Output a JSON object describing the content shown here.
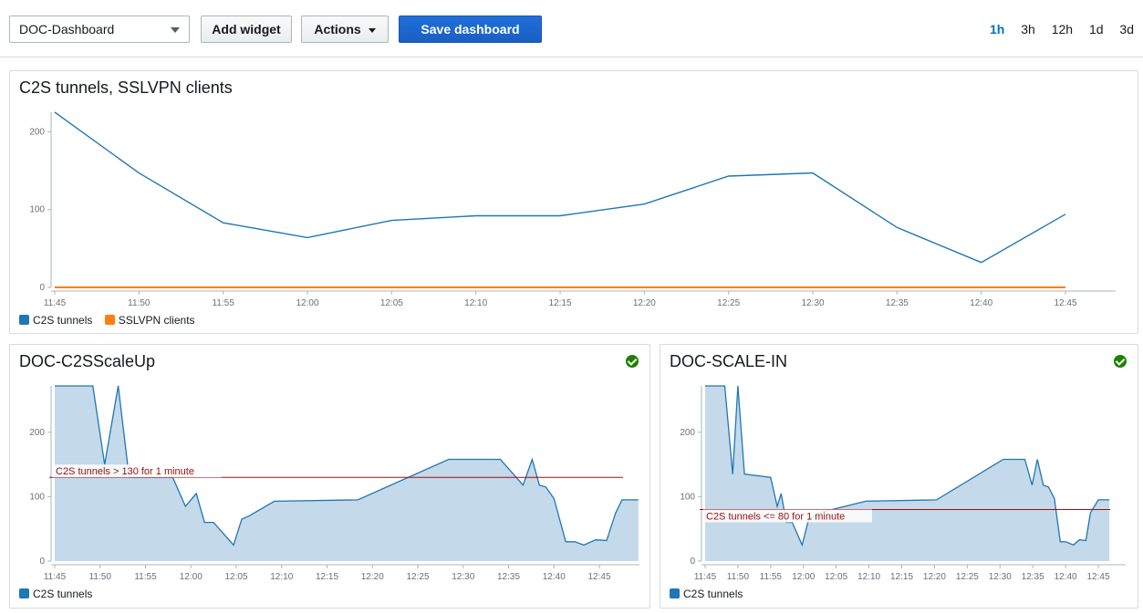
{
  "toolbar": {
    "dashboard_select": "DOC-Dashboard",
    "add_widget": "Add widget",
    "actions": "Actions",
    "save_dashboard": "Save dashboard",
    "time_ranges": [
      "1h",
      "3h",
      "12h",
      "1d",
      "3d"
    ],
    "active_range": "1h"
  },
  "colors": {
    "c2s": "#1f77b4",
    "sslvpn": "#ff7f0e",
    "threshold": "#d13212",
    "area": "#c4d9ea",
    "ok": "#1d8102"
  },
  "widgets": {
    "main": {
      "title": "C2S tunnels, SSLVPN clients"
    },
    "scaleup": {
      "title": "DOC-C2SScaleUp",
      "threshold_label": "C2S tunnels > 130 for 1 minute",
      "state": "ok"
    },
    "scalein": {
      "title": "DOC-SCALE-IN",
      "threshold_label": "C2S tunnels <= 80 for 1 minute",
      "state": "ok"
    }
  },
  "legend": {
    "c2s": "C2S tunnels",
    "sslvpn": "SSLVPN clients"
  },
  "chart_data": [
    {
      "type": "line",
      "title": "C2S tunnels, SSLVPN clients",
      "x": [
        "11:45",
        "11:50",
        "11:55",
        "12:00",
        "12:05",
        "12:10",
        "12:15",
        "12:20",
        "12:25",
        "12:30",
        "12:35",
        "12:40",
        "12:45"
      ],
      "x_ticks": [
        "11:45",
        "11:50",
        "11:55",
        "12:00",
        "12:05",
        "12:10",
        "12:15",
        "12:20",
        "12:25",
        "12:30",
        "12:35",
        "12:40",
        "12:45"
      ],
      "y_ticks": [
        0,
        100,
        200
      ],
      "ylim": [
        0,
        225
      ],
      "series": [
        {
          "name": "C2S tunnels",
          "values": [
            225,
            147,
            83,
            64,
            86,
            92,
            92,
            107,
            143,
            147,
            77,
            32,
            94
          ]
        },
        {
          "name": "SSLVPN clients",
          "values": [
            0,
            0,
            0,
            0,
            0,
            0,
            0,
            0,
            0,
            0,
            0,
            0,
            0
          ]
        }
      ],
      "legend": "bottom-left",
      "grid": false
    },
    {
      "type": "area",
      "title": "DOC-C2SScaleUp",
      "x_ticks": [
        "11:45",
        "11:50",
        "11:55",
        "12:00",
        "12:05",
        "12:10",
        "12:15",
        "12:20",
        "12:25",
        "12:30",
        "12:35",
        "12:40",
        "12:45"
      ],
      "y_ticks": [
        0,
        100,
        200
      ],
      "ylim": [
        0,
        272
      ],
      "x_minutes": [
        0,
        4.2,
        5.5,
        7,
        8.2,
        13,
        14.4,
        15.6,
        16.5,
        17.5,
        19.7,
        20.6,
        21.4,
        24.2,
        33.4,
        43.4,
        49.1,
        51.6,
        52.6,
        53.4,
        54.1,
        55,
        56.3,
        57.3,
        58.3,
        59.6,
        60.8,
        61.8,
        62.5,
        64.3
      ],
      "values": [
        272,
        272,
        150,
        272,
        130,
        130,
        85,
        105,
        60,
        60,
        25,
        65,
        70,
        93,
        95,
        158,
        158,
        118,
        158,
        118,
        115,
        97,
        30,
        30,
        25,
        33,
        32,
        75,
        95,
        95
      ],
      "series": [
        {
          "name": "C2S tunnels"
        }
      ],
      "threshold": {
        "value": 130,
        "label": "C2S tunnels > 130 for 1 minute"
      },
      "legend": "bottom-left"
    },
    {
      "type": "area",
      "title": "DOC-SCALE-IN",
      "x_ticks": [
        "11:45",
        "11:50",
        "11:55",
        "12:00",
        "12:05",
        "12:10",
        "12:15",
        "12:20",
        "12:25",
        "12:30",
        "12:35",
        "12:40",
        "12:45"
      ],
      "y_ticks": [
        0,
        100,
        200
      ],
      "ylim": [
        0,
        272
      ],
      "x_minutes": [
        0,
        3,
        4.2,
        5,
        6,
        10,
        11,
        11.6,
        12.4,
        13.3,
        14.8,
        15.8,
        17.3,
        24.5,
        35.3,
        45.5,
        48.8,
        49.9,
        50.7,
        51.6,
        52.4,
        53.3,
        54.2,
        55,
        56.2,
        57.1,
        58.1,
        58.8,
        60,
        61.7
      ],
      "values": [
        272,
        272,
        135,
        272,
        135,
        130,
        85,
        105,
        60,
        60,
        25,
        65,
        75,
        93,
        95,
        158,
        158,
        118,
        158,
        118,
        115,
        97,
        30,
        30,
        25,
        33,
        32,
        75,
        95,
        95
      ],
      "series": [
        {
          "name": "C2S tunnels"
        }
      ],
      "threshold": {
        "value": 80,
        "label": "C2S tunnels <= 80 for 1 minute"
      },
      "legend": "bottom-left"
    }
  ]
}
